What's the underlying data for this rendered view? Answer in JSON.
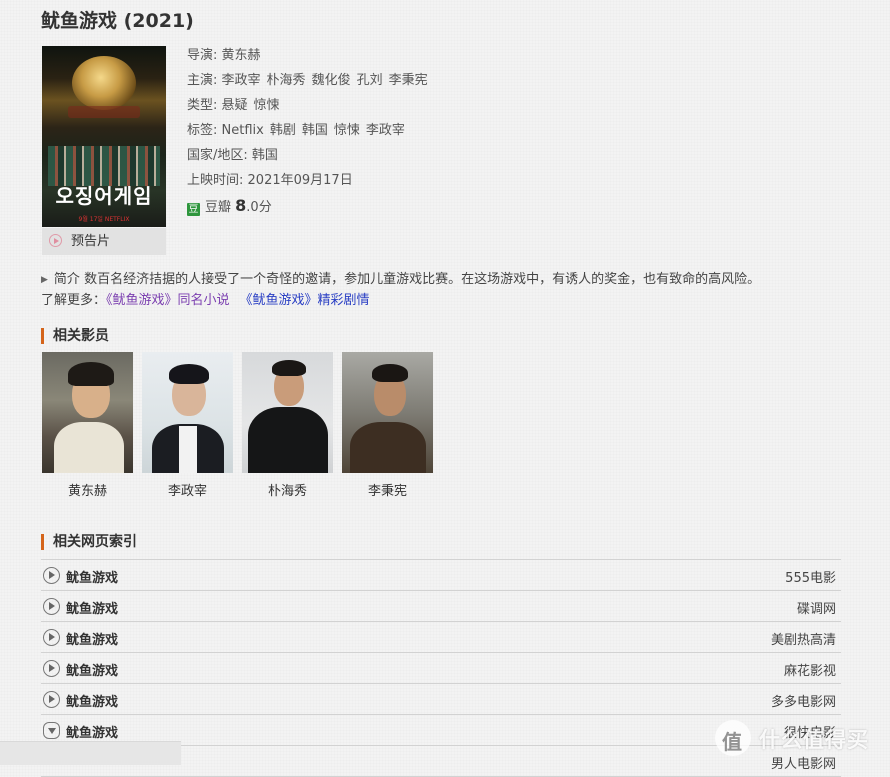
{
  "movie": {
    "title": "鱿鱼游戏 (2021)",
    "poster_text": "오징어게임",
    "poster_date": "9월 17일 NETFLIX",
    "trailer_label": "预告片",
    "director_label": "导演:",
    "director": "黄东赫",
    "cast_label": "主演:",
    "cast": [
      "李政宰",
      "朴海秀",
      "魏化俊",
      "孔刘",
      "李秉宪"
    ],
    "genre_label": "类型:",
    "genres": [
      "悬疑",
      "惊悚"
    ],
    "tags_label": "标签:",
    "tags": [
      "Netflix",
      "韩剧",
      "韩国",
      "惊悚",
      "李政宰"
    ],
    "region_label": "国家/地区:",
    "region": "韩国",
    "release_label": "上映时间:",
    "release": "2021年09月17日",
    "douban_icon": "豆",
    "douban_label": "豆瓣",
    "score": "8.0",
    "score_main": "8",
    "score_rest": ".0分"
  },
  "intro": {
    "label": "简介",
    "text": "数百名经济拮据的人接受了一个奇怪的邀请，参加儿童游戏比赛。在这场游戏中，有诱人的奖金，也有致命的高风险。"
  },
  "more": {
    "label": "了解更多：",
    "link1": "《鱿鱼游戏》同名小说",
    "link2": "《鱿鱼游戏》精彩剧情"
  },
  "related_cast": {
    "heading": "相关影员",
    "people": [
      "黄东赫",
      "李政宰",
      "朴海秀",
      "李秉宪"
    ]
  },
  "web_index": {
    "heading": "相关网页索引",
    "rows": [
      {
        "name": "鱿鱼游戏",
        "source": "555电影",
        "icon": "play-icon"
      },
      {
        "name": "鱿鱼游戏",
        "source": "碟调网",
        "icon": "play-icon"
      },
      {
        "name": "鱿鱼游戏",
        "source": "美剧热高清",
        "icon": "play-icon"
      },
      {
        "name": "鱿鱼游戏",
        "source": "麻花影视",
        "icon": "play-icon"
      },
      {
        "name": "鱿鱼游戏",
        "source": "多多电影网",
        "icon": "play-icon"
      },
      {
        "name": "鱿鱼游戏",
        "source": "很快电影",
        "icon": "cloud-download-icon"
      },
      {
        "name": "",
        "source": "男人电影网",
        "icon": ""
      }
    ]
  },
  "watermark": "值 什么值得买",
  "colors": {
    "accent": "#d4641a",
    "douban": "#2e963d",
    "link_visited": "#7b3fb0",
    "link": "#2a3fc4"
  }
}
